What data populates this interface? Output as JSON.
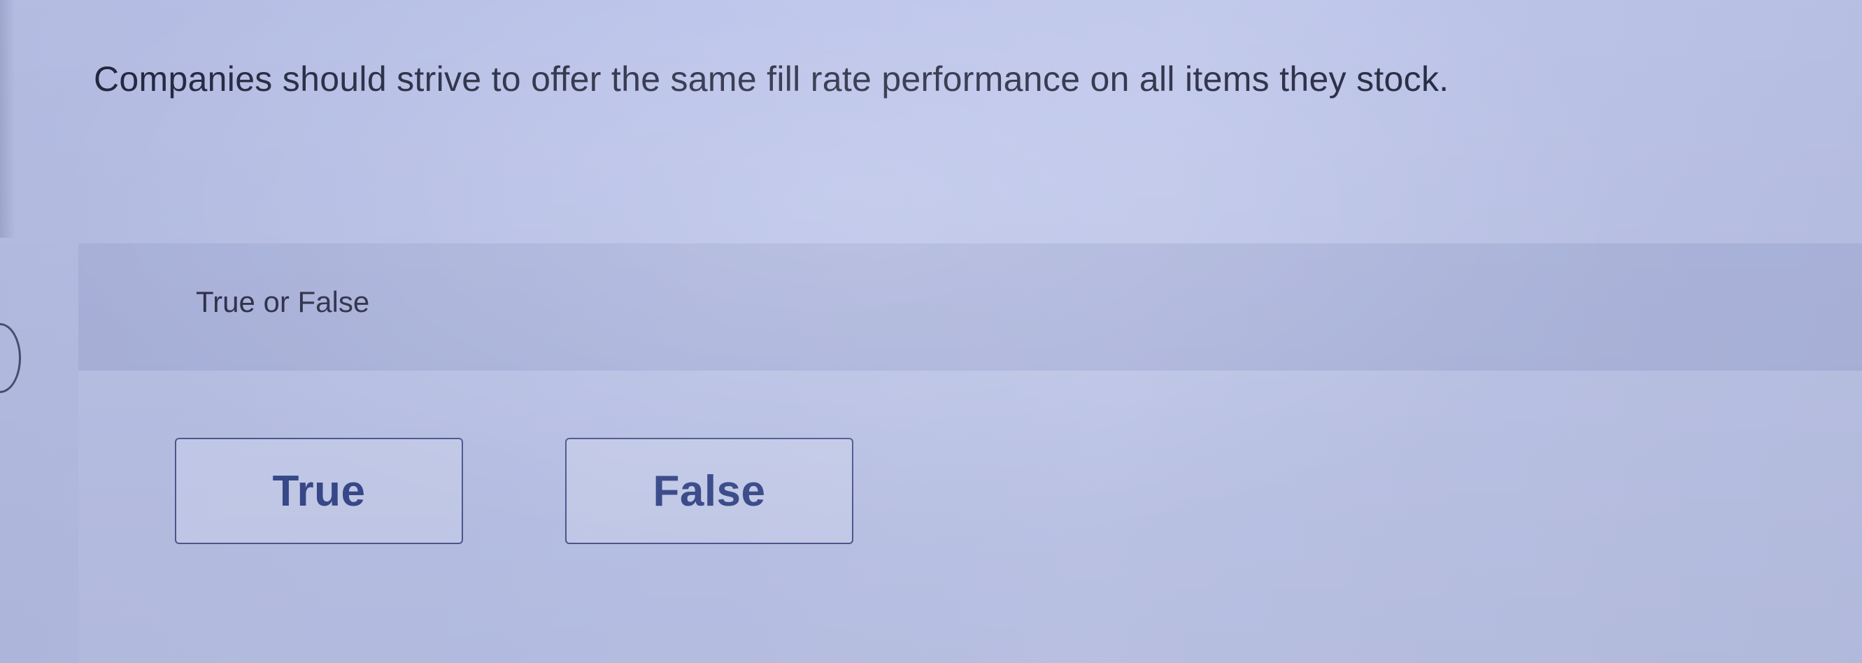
{
  "question": {
    "text": "Companies should strive to offer the same fill rate performance on all items they stock."
  },
  "question_type": {
    "label": "True or False"
  },
  "choices": [
    {
      "label": "True"
    },
    {
      "label": "False"
    }
  ],
  "colors": {
    "background": "#bcc5ee",
    "button_border": "#4f5a92",
    "button_text": "#3a4b8e",
    "text": "#232740"
  }
}
